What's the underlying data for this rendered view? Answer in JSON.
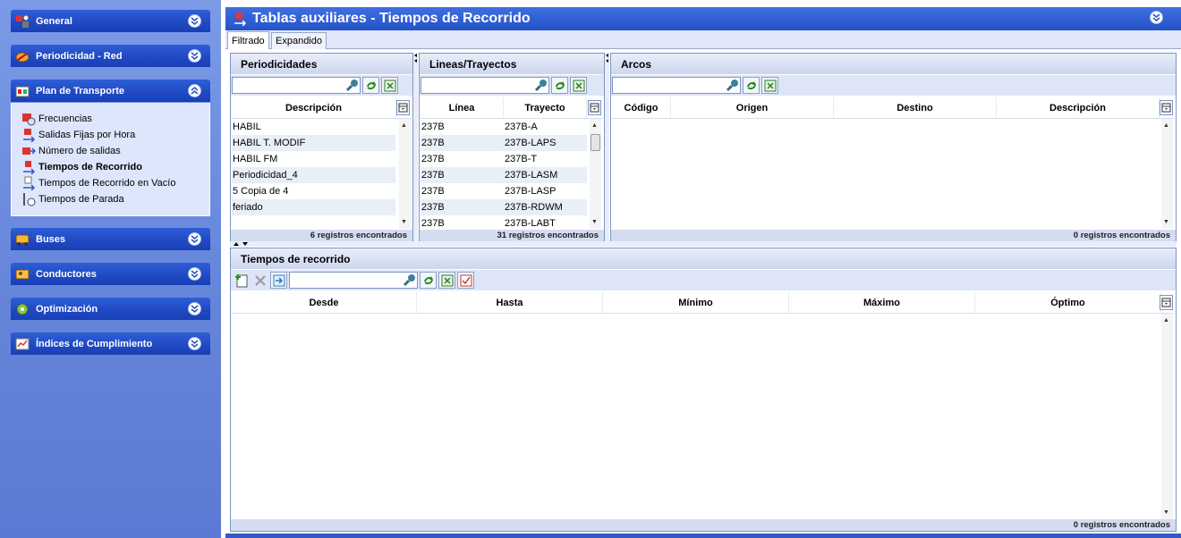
{
  "sidebar": {
    "sections": [
      {
        "label": "General",
        "icon": "general-icon",
        "expanded": false
      },
      {
        "label": "Periodicidad - Red",
        "icon": "periodicity-icon",
        "expanded": false
      },
      {
        "label": "Plan de Transporte",
        "icon": "transport-plan-icon",
        "expanded": true
      },
      {
        "label": "Buses",
        "icon": "bus-icon",
        "expanded": false
      },
      {
        "label": "Conductores",
        "icon": "driver-icon",
        "expanded": false
      },
      {
        "label": "Optimización",
        "icon": "optimization-icon",
        "expanded": false
      },
      {
        "label": "Índices de Cumplimiento",
        "icon": "compliance-icon",
        "expanded": false
      }
    ],
    "plan_items": [
      {
        "label": "Frecuencias",
        "icon": "frequency-icon",
        "active": false
      },
      {
        "label": "Salidas Fijas por Hora",
        "icon": "fixed-departures-icon",
        "active": false
      },
      {
        "label": "Número de salidas",
        "icon": "departures-count-icon",
        "active": false
      },
      {
        "label": "Tiempos de Recorrido",
        "icon": "travel-time-icon",
        "active": true
      },
      {
        "label": "Tiempos de Recorrido en Vacío",
        "icon": "empty-travel-time-icon",
        "active": false
      },
      {
        "label": "Tiempos de Parada",
        "icon": "stop-time-icon",
        "active": false
      }
    ]
  },
  "window": {
    "title": "Tablas auxiliares - Tiempos de Recorrido"
  },
  "tabs": [
    "Filtrado",
    "Expandido"
  ],
  "periodicidades": {
    "title": "Periodicidades",
    "search_value": "",
    "columns": [
      "Descripción"
    ],
    "rows": [
      "HABIL",
      "HABIL T. MODIF",
      "HABIL FM",
      "Periodicidad_4",
      "5 Copia de 4",
      "feriado"
    ],
    "footer": "6 registros encontrados"
  },
  "lineas": {
    "title": "Lineas/Trayectos",
    "search_value": "",
    "columns": [
      "Línea",
      "Trayecto"
    ],
    "rows": [
      [
        "237B",
        "237B-A"
      ],
      [
        "237B",
        "237B-LAPS"
      ],
      [
        "237B",
        "237B-T"
      ],
      [
        "237B",
        "237B-LASM"
      ],
      [
        "237B",
        "237B-LASP"
      ],
      [
        "237B",
        "237B-RDWM"
      ],
      [
        "237B",
        "237B-LABT"
      ]
    ],
    "footer": "31 registros encontrados"
  },
  "arcos": {
    "title": "Arcos",
    "search_value": "",
    "columns": [
      "Código",
      "Origen",
      "Destino",
      "Descripción"
    ],
    "footer": "0 registros encontrados"
  },
  "tiempos": {
    "title": "Tiempos de recorrido",
    "search_value": "",
    "columns": [
      "Desde",
      "Hasta",
      "Mínimo",
      "Máximo",
      "Óptimo"
    ],
    "footer": "0 registros encontrados"
  }
}
